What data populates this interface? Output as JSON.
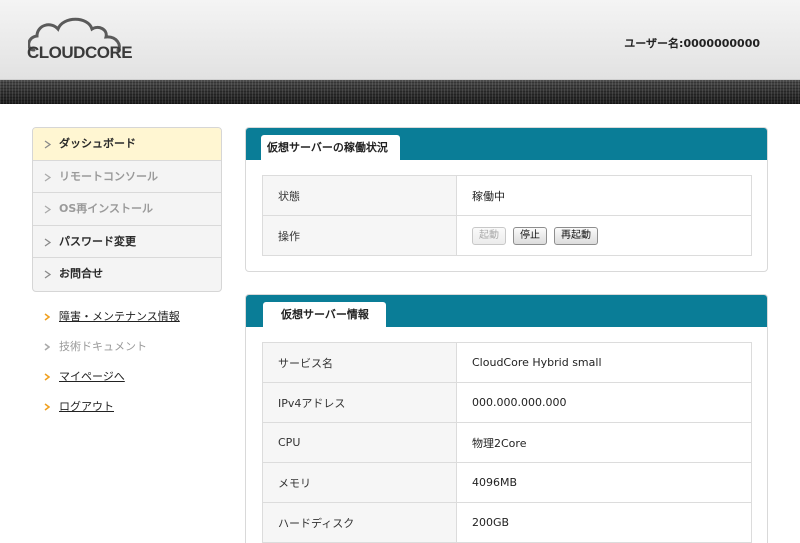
{
  "header": {
    "logo_text": "CLOUDCORE",
    "username": "ユーザー名:0000000000"
  },
  "sidebar": {
    "menu": [
      {
        "label": "ダッシュボード",
        "state": "active"
      },
      {
        "label": "リモートコンソール",
        "state": "disabled"
      },
      {
        "label": "OS再インストール",
        "state": "disabled"
      },
      {
        "label": "パスワード変更",
        "state": "normal"
      },
      {
        "label": "お問合せ",
        "state": "normal"
      }
    ],
    "links": [
      {
        "label": "障害・メンテナンス情報",
        "state": "normal"
      },
      {
        "label": "技術ドキュメント",
        "state": "disabled"
      },
      {
        "label": "マイページへ",
        "state": "normal"
      },
      {
        "label": "ログアウト",
        "state": "normal"
      }
    ]
  },
  "status_panel": {
    "title": "仮想サーバーの稼働状況",
    "status_label": "状態",
    "status_value": "稼働中",
    "status_color": "#22c422",
    "ops_label": "操作",
    "buttons": {
      "start": "起動",
      "stop": "停止",
      "restart": "再起動"
    }
  },
  "info_panel": {
    "title": "仮想サーバー情報",
    "rows": [
      {
        "key": "サービス名",
        "value": "CloudCore Hybrid small"
      },
      {
        "key": "IPv4アドレス",
        "value": "000.000.000.000"
      },
      {
        "key": "CPU",
        "value": "物理2Core"
      },
      {
        "key": "メモリ",
        "value": "4096MB"
      },
      {
        "key": "ハードディスク",
        "value": "200GB"
      }
    ]
  },
  "colors": {
    "accent": "#0a7d97",
    "active_bg": "#fff6d2",
    "bullet": "#f0a020"
  }
}
